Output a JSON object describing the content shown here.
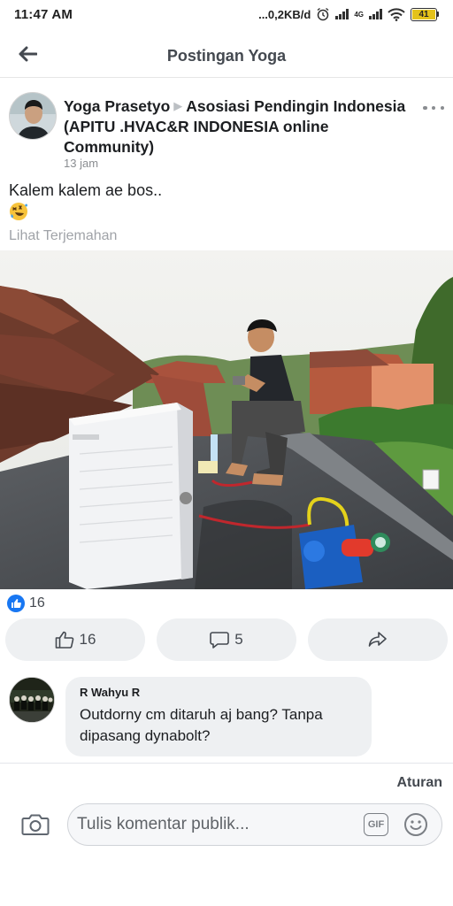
{
  "status_bar": {
    "time": "11:47 AM",
    "network": "...0,2KB/d",
    "network_type": "4G",
    "battery": "41"
  },
  "header": {
    "title": "Postingan Yoga",
    "back_icon": "arrow-left-icon"
  },
  "post": {
    "author": "Yoga Prasetyo",
    "separator_icon": "triangle-right-icon",
    "group": "Asosiasi Pendingin Indonesia (APITU .HVAC&R INDONESIA online Community)",
    "time": "13 jam",
    "text": "Kalem kalem ae bos..",
    "emoji": "rolling-laughing-emoji",
    "translate_link": "Lihat Terjemahan",
    "reaction_count": "16"
  },
  "actions": {
    "likes": "16",
    "comments": "5"
  },
  "comment": {
    "author": "R Wahyu R",
    "text": "Outdorny cm ditaruh aj bang?  Tanpa dipasang dynabolt?"
  },
  "footer": {
    "rules": "Aturan",
    "input_placeholder": "Tulis komentar publik...",
    "gif_label": "GIF"
  },
  "colors": {
    "accent": "#1877f2",
    "button_bg": "#eef0f2",
    "muted_text": "#8a8d91",
    "battery_fill": "#e4c21a"
  }
}
